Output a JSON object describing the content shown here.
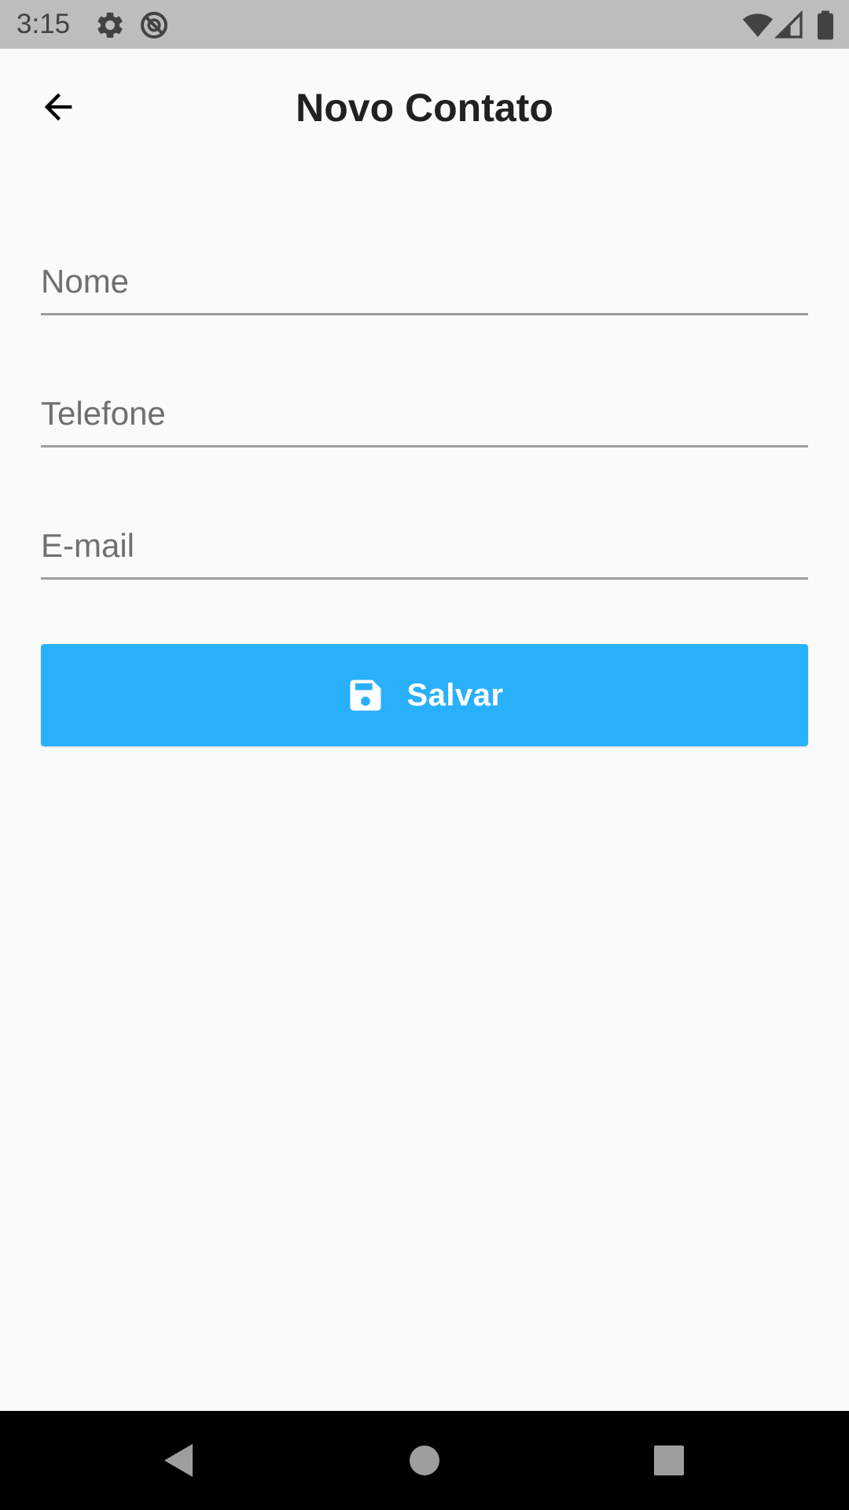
{
  "status_bar": {
    "time": "3:15",
    "icons": [
      "settings-icon",
      "sync-disabled-icon",
      "wifi-icon",
      "signal-icon",
      "battery-icon"
    ]
  },
  "app_bar": {
    "title": "Novo Contato",
    "back_icon": "arrow-back-icon"
  },
  "form": {
    "name_placeholder": "Nome",
    "phone_placeholder": "Telefone",
    "email_placeholder": "E-mail",
    "name_value": "",
    "phone_value": "",
    "email_value": ""
  },
  "save_button": {
    "label": "Salvar",
    "icon": "save-icon"
  },
  "nav_bar": {
    "buttons": [
      "back-nav-icon",
      "home-nav-icon",
      "recents-nav-icon"
    ]
  },
  "colors": {
    "accent": "#29b0fb",
    "status_bar_bg": "#bdbdbd",
    "background": "#fafafa",
    "nav_bar_bg": "#000000"
  }
}
